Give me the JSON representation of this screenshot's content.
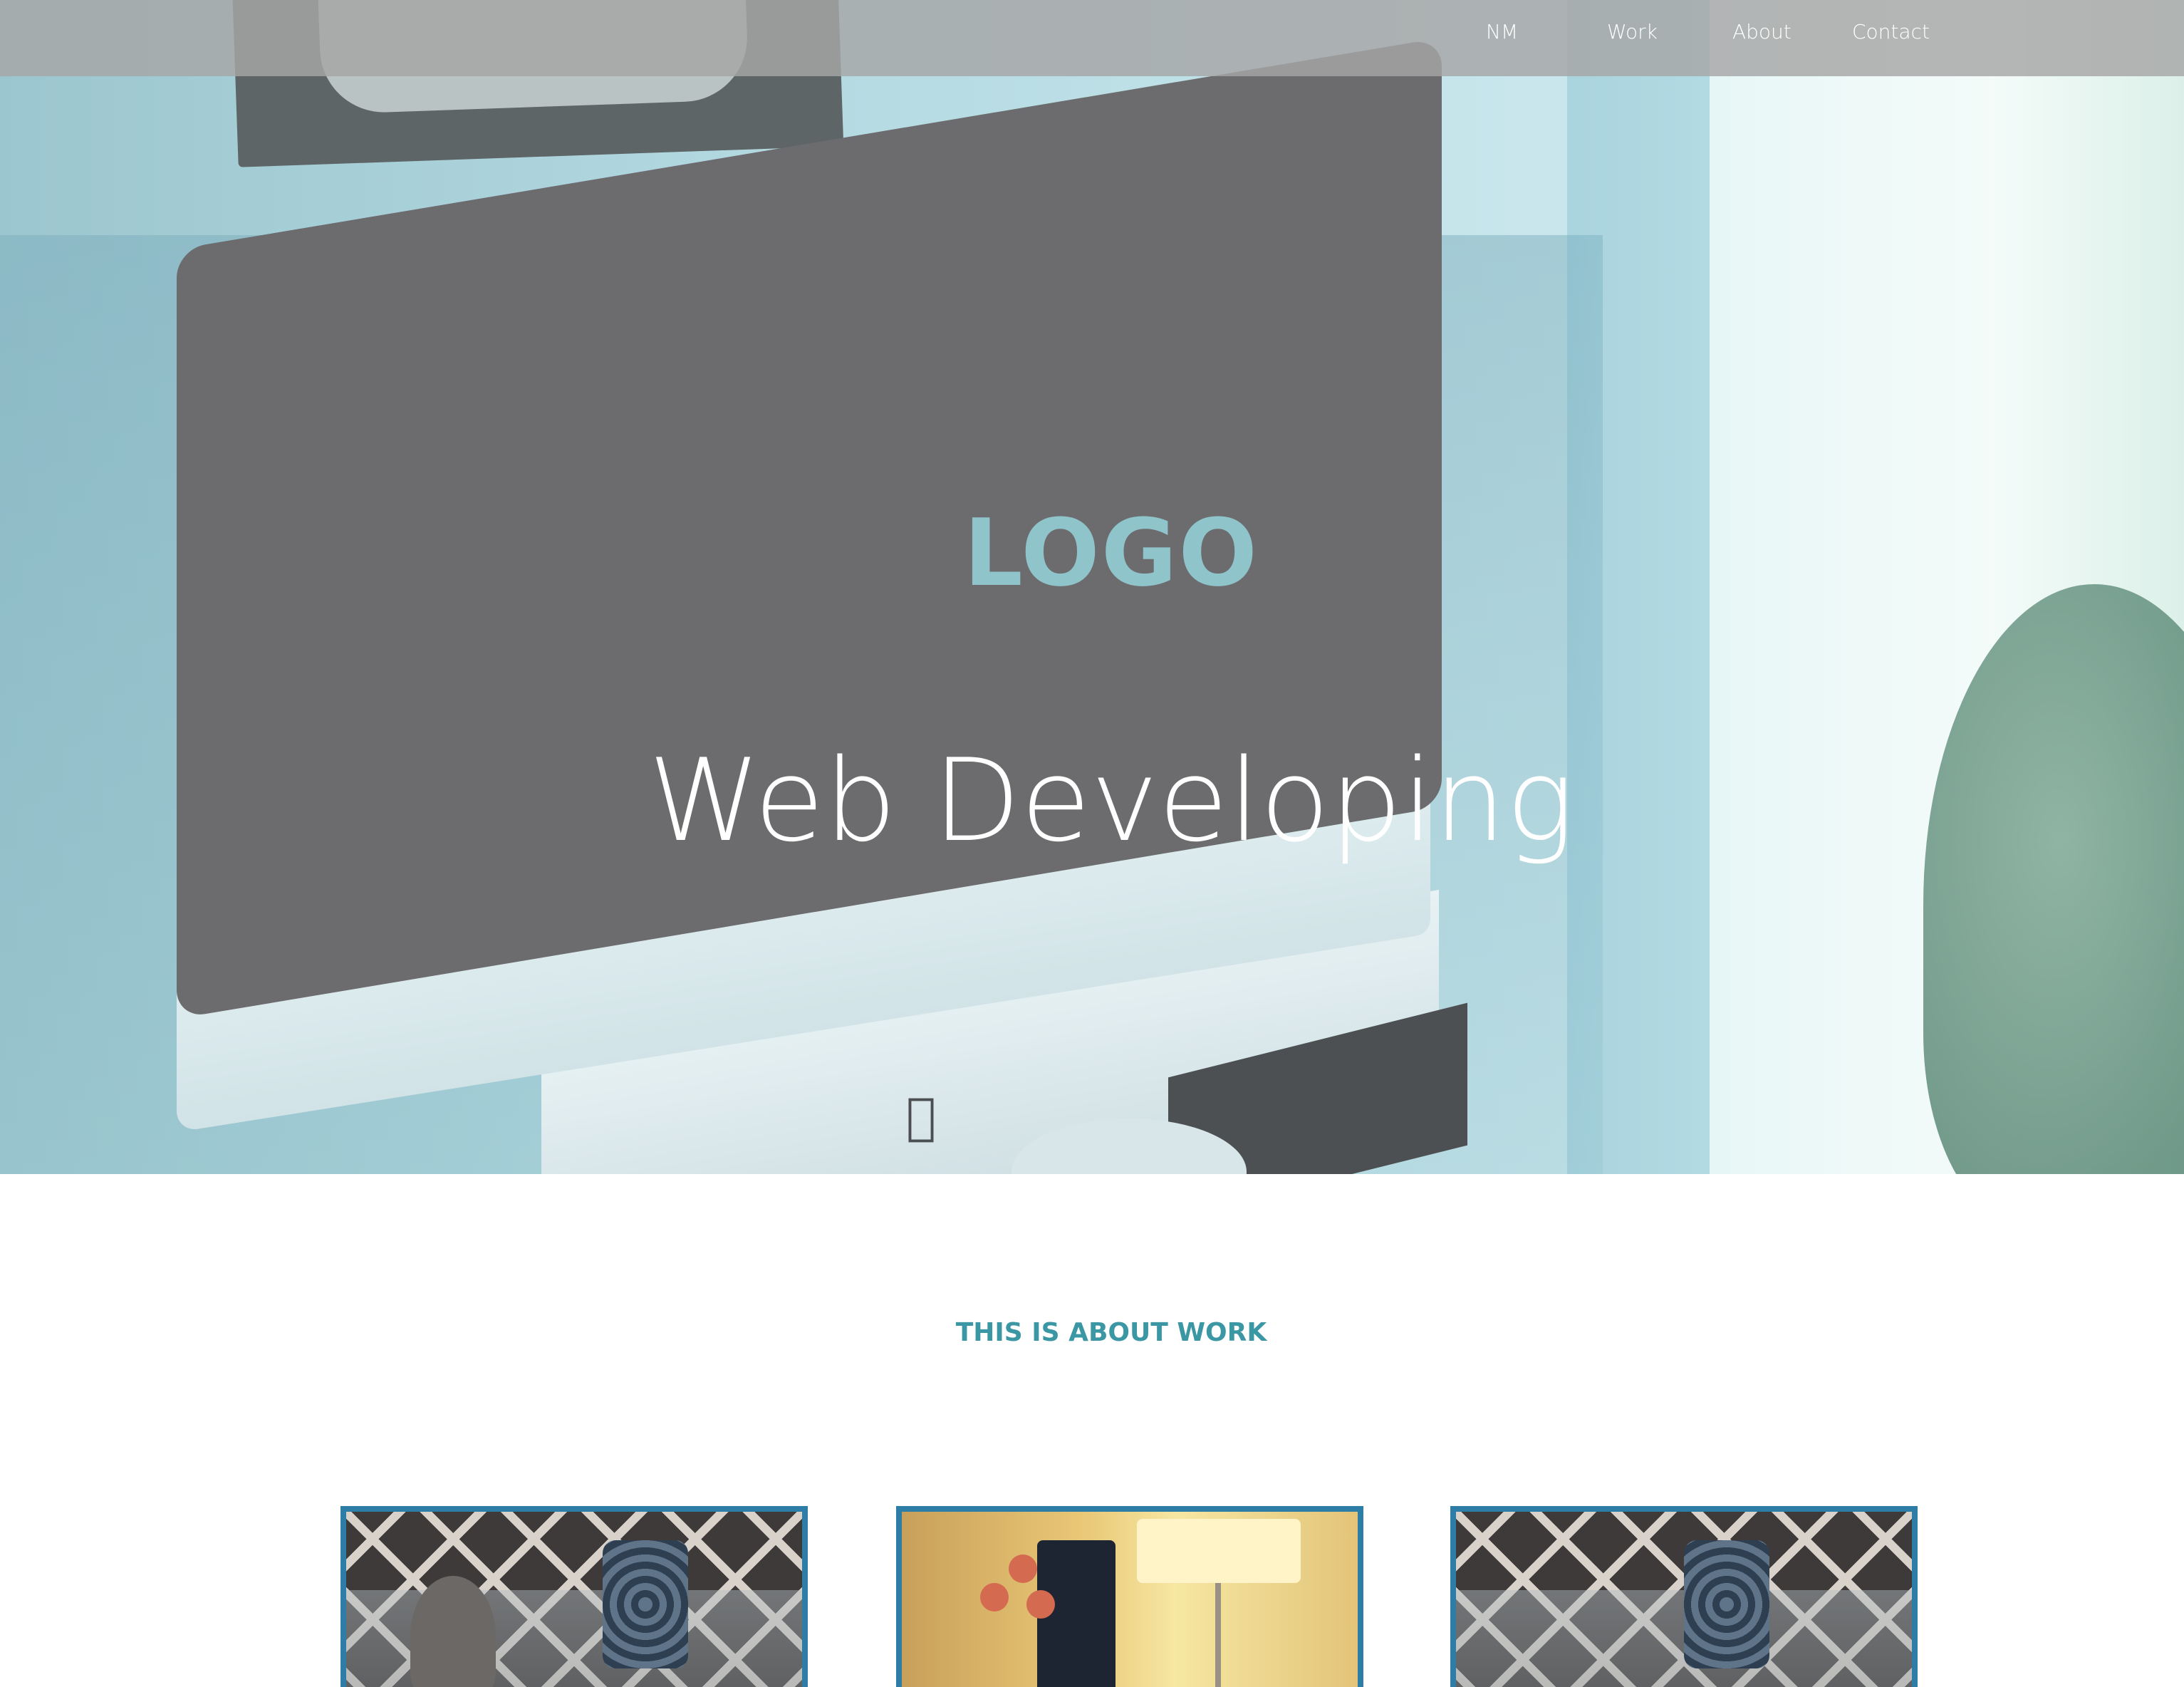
{
  "nav": {
    "items": [
      {
        "label": "NM"
      },
      {
        "label": "Work"
      },
      {
        "label": "About"
      },
      {
        "label": "Contact"
      }
    ]
  },
  "hero": {
    "logo": "LOGO",
    "tagline": "Web Developing"
  },
  "work": {
    "title": "THIS IS ABOUT WORK"
  },
  "colors": {
    "accent": "#3c97a4",
    "logo": "#8fc4cb",
    "card_border": "#2e7da6",
    "nav_background": "#a6a6a6"
  }
}
